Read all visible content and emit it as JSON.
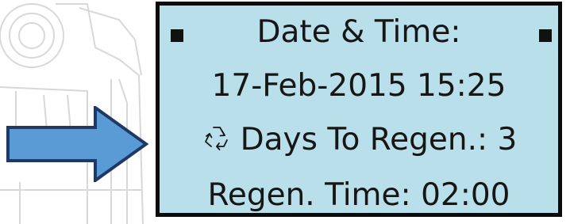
{
  "display": {
    "title": "Date & Time:",
    "datetime": "17-Feb-2015 15:25",
    "days_to_regen": "Days To Regen.: 3",
    "regen_time": "Regen. Time: 02:00"
  },
  "icons": {
    "left_marker": "square-marker-icon",
    "right_marker": "square-marker-icon",
    "regen": "recycle-icon",
    "pointer": "arrow-right-icon"
  },
  "colors": {
    "lcd_background": "#b9dfea",
    "lcd_border": "#0b0b0b",
    "arrow_fill": "#5b9bd5",
    "arrow_stroke": "#1f3864"
  }
}
